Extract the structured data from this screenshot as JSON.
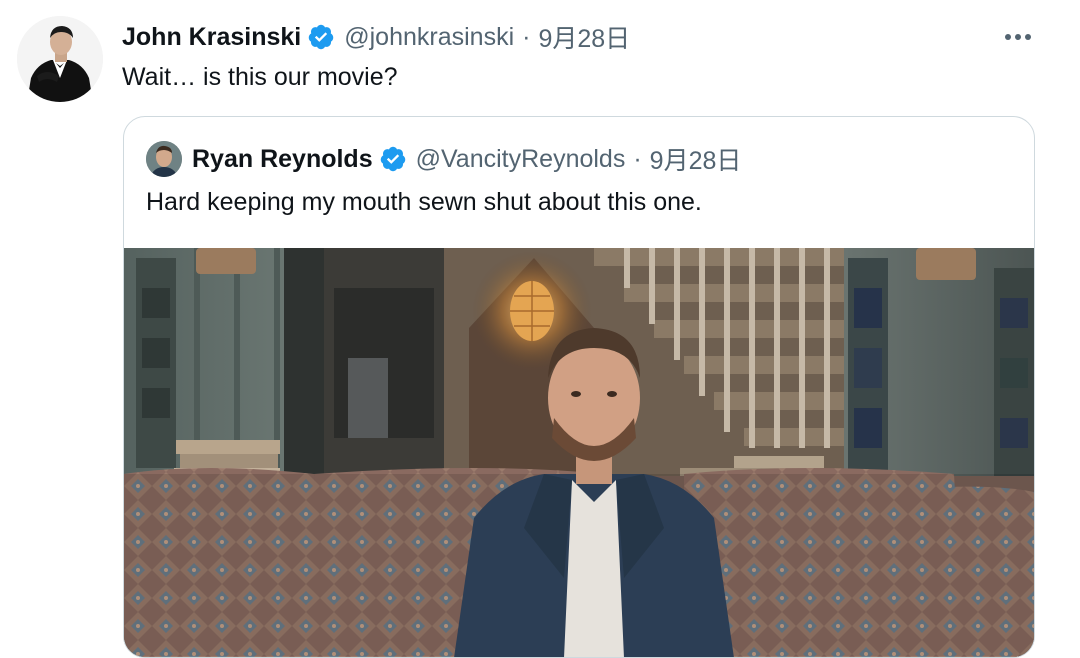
{
  "tweet": {
    "author": {
      "display_name": "John Krasinski",
      "handle": "@johnkrasinski",
      "verified": true
    },
    "separator": "·",
    "date": "9月28日",
    "text": "Wait… is this our movie?",
    "icons": {
      "verified": "verified-badge-icon",
      "more": "more-options-icon"
    }
  },
  "quote": {
    "author": {
      "display_name": "Ryan Reynolds",
      "handle": "@VancityReynolds",
      "verified": true
    },
    "separator": "·",
    "date": "9月28日",
    "text": "Hard keeping my mouth sewn shut about this one.",
    "media": {
      "kind": "video-still",
      "alt": ""
    }
  },
  "colors": {
    "text_primary": "#0f1419",
    "text_secondary": "#536471",
    "verified_blue": "#1d9bf0",
    "border": "#cfd9de"
  }
}
